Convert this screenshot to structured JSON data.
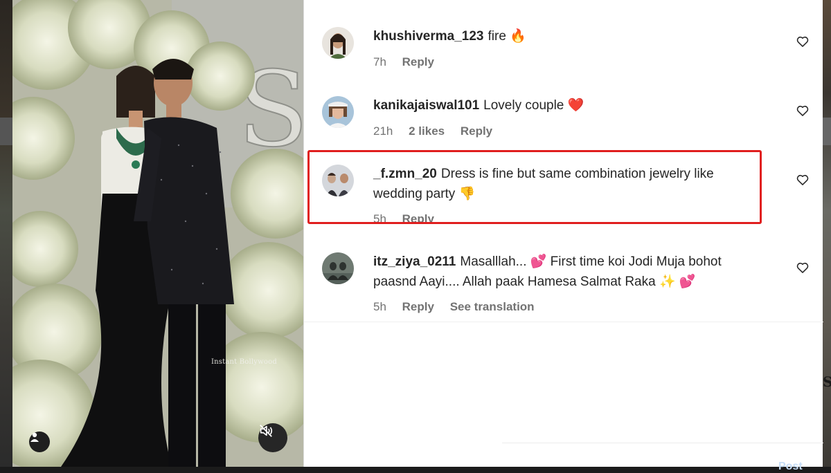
{
  "media": {
    "watermark": "Instant Bollywood",
    "tag_icon": "person-icon",
    "mute_icon": "muted-speaker-icon"
  },
  "comments": [
    {
      "username": "khushiverma_123",
      "text": "fire",
      "emoji": "🔥",
      "time": "7h",
      "likes": "",
      "reply": "Reply",
      "translate": ""
    },
    {
      "username": "kanikajaiswal101",
      "text": "Lovely couple",
      "emoji": "❤️",
      "time": "21h",
      "likes": "2 likes",
      "reply": "Reply",
      "translate": ""
    },
    {
      "username": "_f.zmn_20",
      "text": "Dress is fine but same combination jewelry like wedding party",
      "emoji": "👎",
      "time": "5h",
      "likes": "",
      "reply": "Reply",
      "translate": ""
    },
    {
      "username": "itz_ziya_0211",
      "text": "Masalllah... 💕 First time koi Jodi Muja bohot paasnd Aayi.... Allah paak Hamesa Salmat Raka ✨",
      "emoji": "💕",
      "time": "5h",
      "likes": "",
      "reply": "Reply",
      "translate": "See translation"
    }
  ],
  "colors": {
    "highlight": "#e01e1e",
    "muted_text": "#737373",
    "primary_text": "#262626"
  },
  "footer": {
    "post_hint": "Post"
  }
}
